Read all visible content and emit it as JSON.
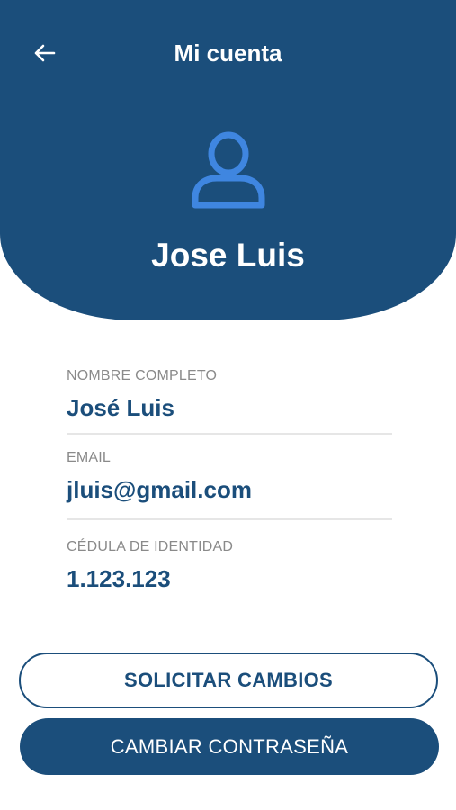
{
  "header": {
    "title": "Mi cuenta",
    "back_icon": "arrow-left-icon",
    "avatar_icon": "user-icon",
    "user_name": "Jose Luis"
  },
  "fields": [
    {
      "label": "NOMBRE COMPLETO",
      "value": "José Luis"
    },
    {
      "label": "EMAIL",
      "value": "jluis@gmail.com"
    },
    {
      "label": "CÉDULA DE IDENTIDAD",
      "value": "1.123.123"
    }
  ],
  "buttons": {
    "request_changes": "SOLICITAR CAMBIOS",
    "change_password": "CAMBIAR CONTRASEÑA"
  },
  "colors": {
    "primary": "#1b4e7b",
    "avatar_accent": "#3f86e0",
    "label_gray": "#8a8a8a",
    "divider": "#e6e6e6",
    "background": "#ffffff"
  }
}
